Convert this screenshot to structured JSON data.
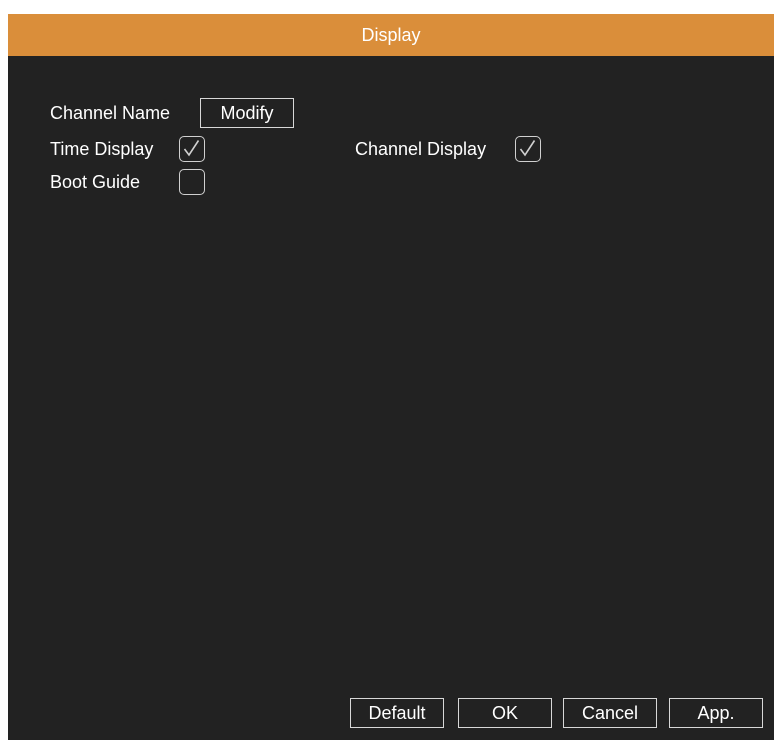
{
  "window": {
    "title": "Display"
  },
  "settings": {
    "channel_name": {
      "label": "Channel Name",
      "button_label": "Modify"
    },
    "time_display": {
      "label": "Time Display",
      "checked": true
    },
    "channel_display": {
      "label": "Channel Display",
      "checked": true
    },
    "boot_guide": {
      "label": "Boot Guide",
      "checked": false
    }
  },
  "footer": {
    "default_label": "Default",
    "ok_label": "OK",
    "cancel_label": "Cancel",
    "apply_label": "App."
  },
  "colors": {
    "titlebar": "#da8e3a",
    "background": "#222222",
    "text": "#ffffff"
  }
}
